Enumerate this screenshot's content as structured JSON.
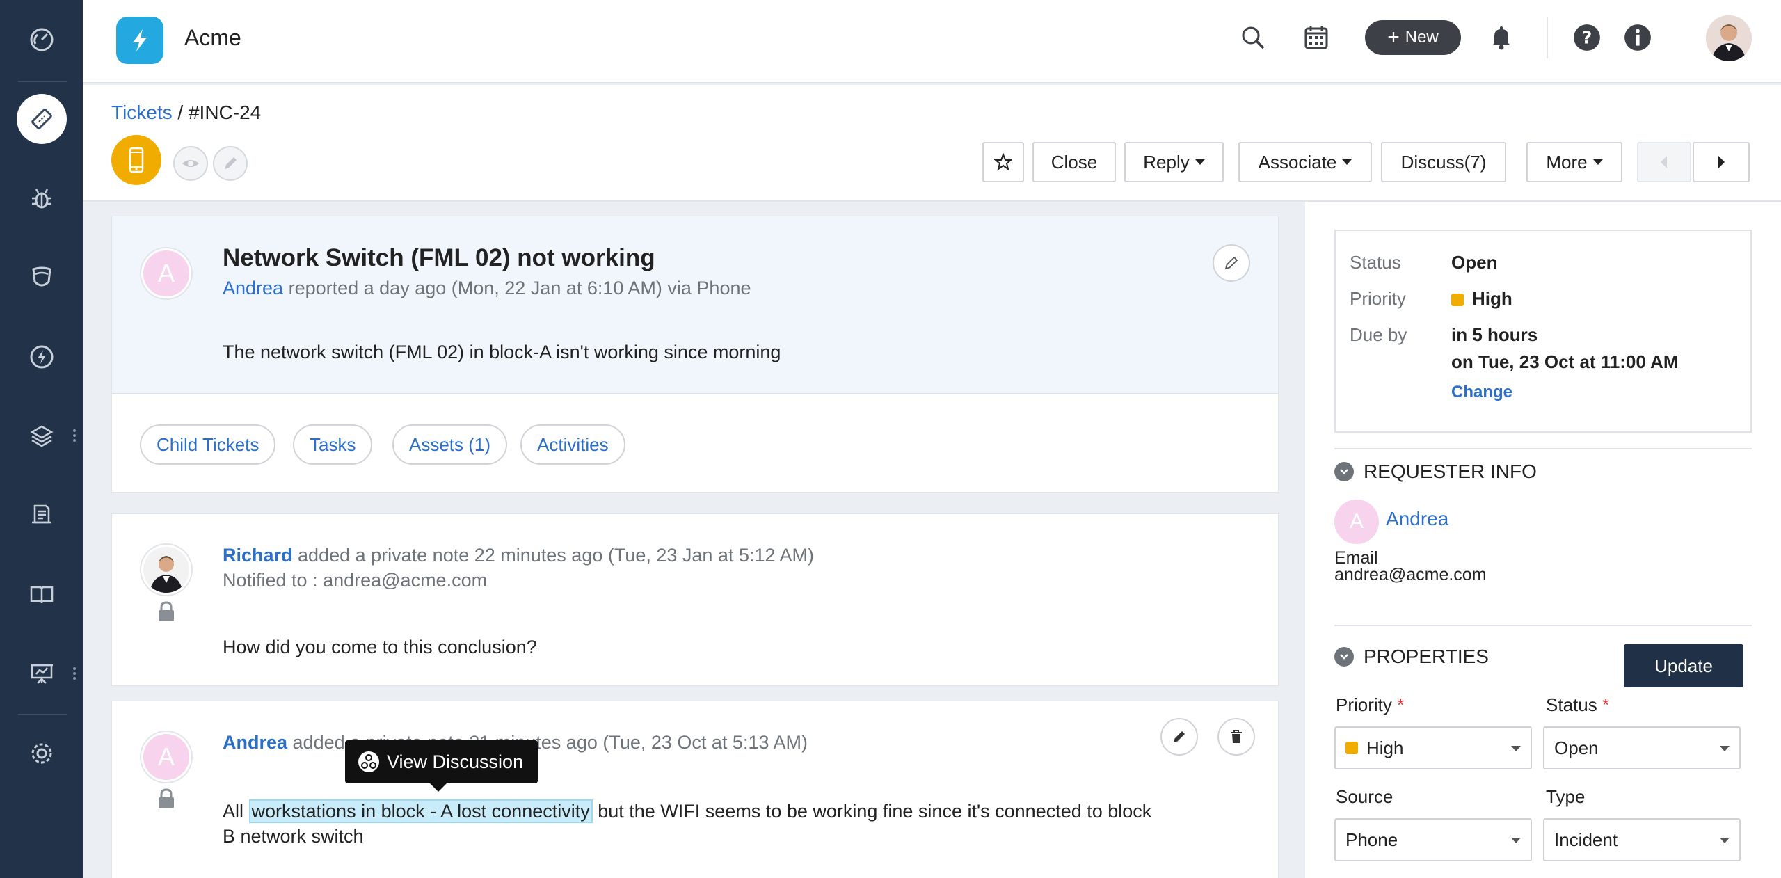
{
  "app": {
    "brand": "Acme"
  },
  "header": {
    "new_label": "New"
  },
  "breadcrumb": {
    "root": "Tickets",
    "separator": " / ",
    "current": "#INC-24"
  },
  "actions": {
    "close": "Close",
    "reply": "Reply",
    "associate": "Associate",
    "discuss": "Discuss(7)",
    "more": "More"
  },
  "ticket": {
    "avatar_initial": "A",
    "title": "Network Switch (FML 02) not working",
    "reporter": "Andrea",
    "reported_meta": " reported a day ago (Mon, 22 Jan at 6:10 AM) via Phone",
    "description": "The network switch (FML 02) in block-A isn't working since morning"
  },
  "tabs": [
    {
      "label": "Child Tickets"
    },
    {
      "label": "Tasks"
    },
    {
      "label": "Assets (1)"
    },
    {
      "label": "Activities"
    }
  ],
  "notes": [
    {
      "author": "Richard",
      "meta": " added a private note 22 minutes ago (Tue, 23 Jan at 5:12 AM)",
      "notified": "Notified to : andrea@acme.com",
      "body": "How did you come to this conclusion?"
    },
    {
      "author": "Andrea",
      "avatar_initial": "A",
      "meta": " added a private note 21 minutes ago (Tue, 23 Oct at 5:13 AM)",
      "body_pre": "All ",
      "body_highlight": "workstations in block - A lost connectivity",
      "body_post": " but the WIFI seems to be working fine since it's connected to block",
      "body_line2": "B network switch"
    }
  ],
  "tooltip": {
    "label": "View Discussion"
  },
  "summary": {
    "status_label": "Status",
    "status_value": "Open",
    "priority_label": "Priority",
    "priority_value": "High",
    "due_label": "Due by",
    "due_value1": "in 5 hours",
    "due_value2": "on Tue, 23 Oct at 11:00 AM",
    "change": "Change",
    "priority_color": "#f0ad00"
  },
  "requester": {
    "section_title": "REQUESTER INFO",
    "avatar_initial": "A",
    "name": "Andrea",
    "email_label": "Email",
    "email": "andrea@acme.com"
  },
  "properties": {
    "section_title": "PROPERTIES",
    "update": "Update",
    "priority_label": "Priority",
    "priority_value": "High",
    "status_label": "Status",
    "status_value": "Open",
    "source_label": "Source",
    "source_value": "Phone",
    "type_label": "Type",
    "type_value": "Incident",
    "required_mark": "*"
  },
  "colors": {
    "sidebar": "#223248",
    "accent": "#2c6fc9",
    "badge": "#f0ad00",
    "primary_button": "#1f3047"
  }
}
